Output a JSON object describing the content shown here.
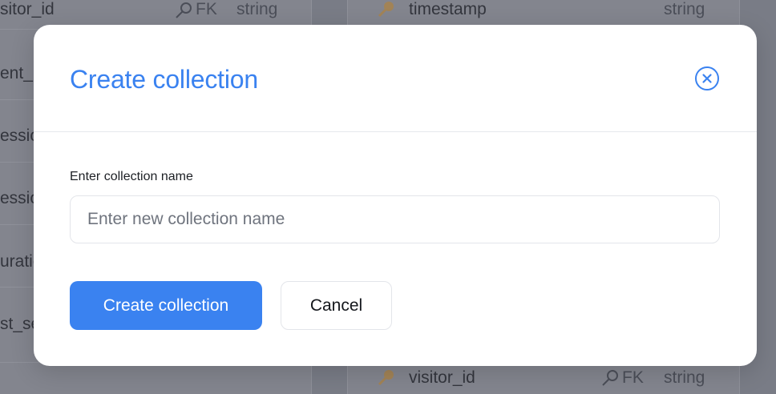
{
  "background": {
    "left_table": {
      "rows": [
        {
          "name": "sitor_id",
          "tag": "FK",
          "type": "string"
        },
        {
          "name": "ent_"
        },
        {
          "name": "essio"
        },
        {
          "name": "essio"
        },
        {
          "name": "uratio"
        },
        {
          "name": "st_se"
        }
      ]
    },
    "right_table": {
      "top_row": {
        "name": "timestamp",
        "type": "string"
      },
      "bottom_row": {
        "name": "visitor_id",
        "tag": "FK",
        "type": "string"
      }
    }
  },
  "modal": {
    "title": "Create collection",
    "field_label": "Enter collection name",
    "input_value": "",
    "input_placeholder": "Enter new collection name",
    "primary_label": "Create collection",
    "secondary_label": "Cancel",
    "accent_color": "#3a82f0"
  },
  "icons": {
    "close": "close-circle-icon",
    "key": "key-icon"
  }
}
